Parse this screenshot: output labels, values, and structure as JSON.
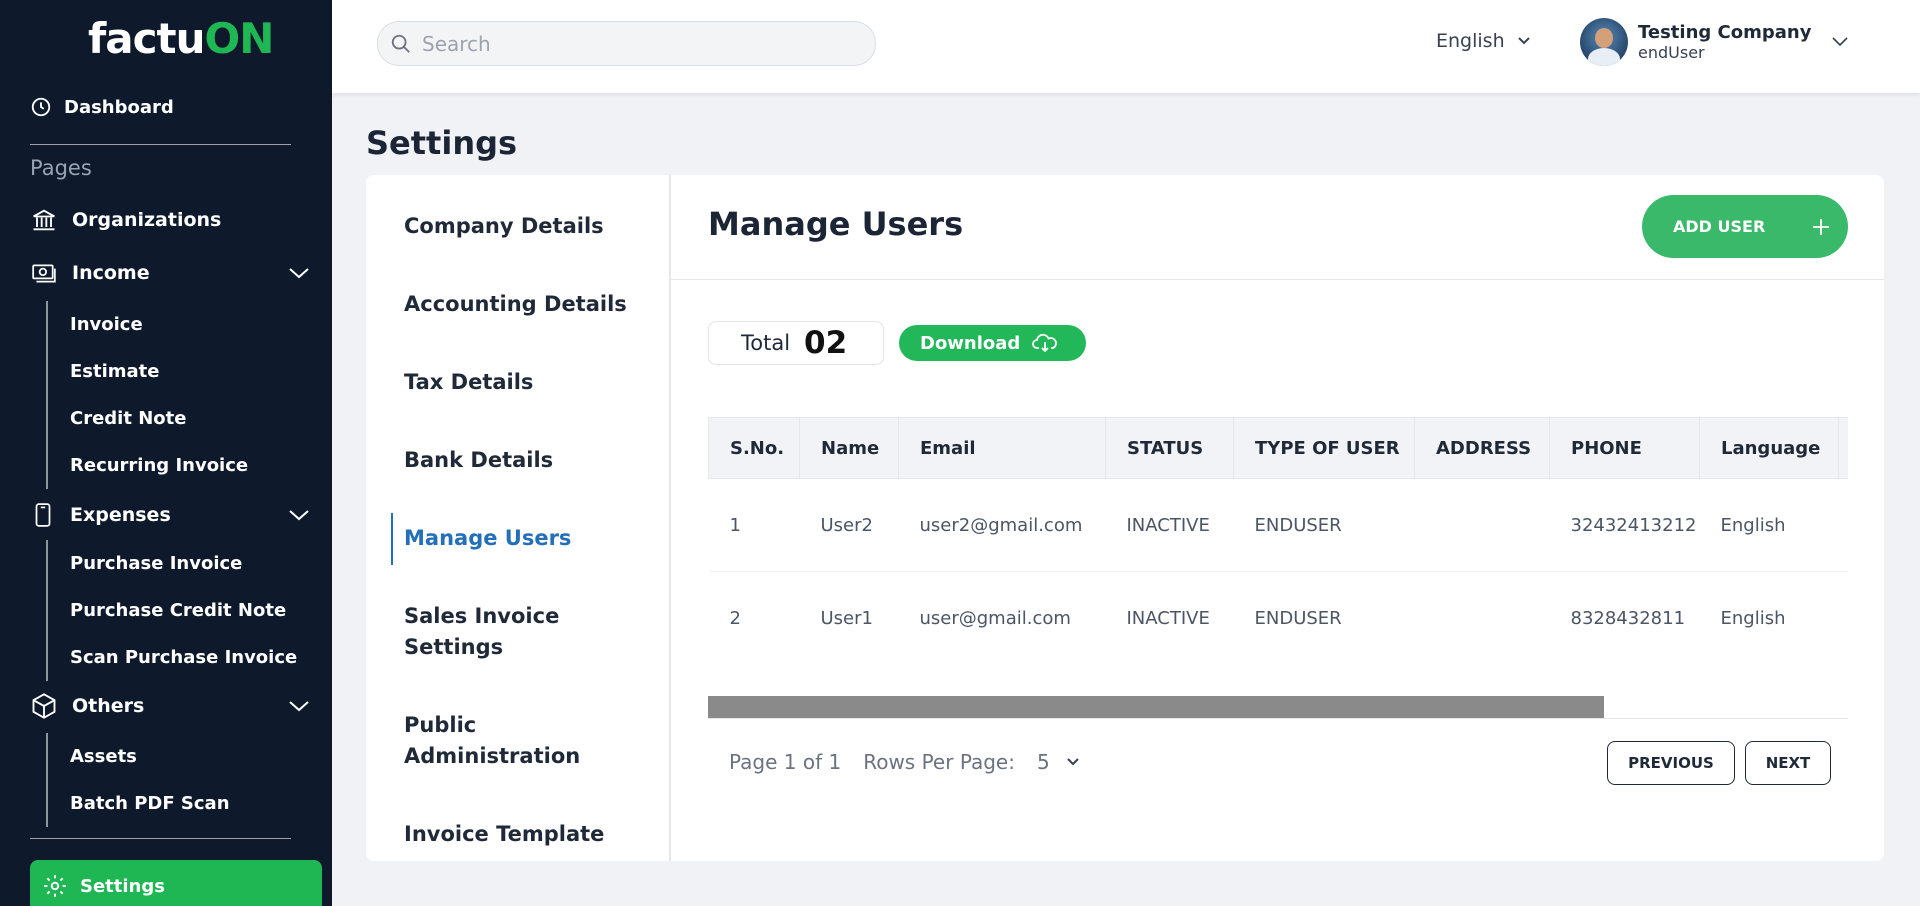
{
  "brand": {
    "logo_part1": "actu",
    "logo_part2": "ON",
    "logo_prefix": "f"
  },
  "sidebar": {
    "dashboard": "Dashboard",
    "pages_label": "Pages",
    "organizations": "Organizations",
    "income": {
      "label": "Income",
      "items": [
        "Invoice",
        "Estimate",
        "Credit Note",
        "Recurring Invoice"
      ]
    },
    "expenses": {
      "label": "Expenses",
      "items": [
        "Purchase Invoice",
        "Purchase Credit Note",
        "Scan Purchase Invoice"
      ]
    },
    "others": {
      "label": "Others",
      "items": [
        "Assets",
        "Batch PDF Scan"
      ]
    },
    "settings": "Settings"
  },
  "header": {
    "search_placeholder": "Search",
    "language": "English",
    "user_name": "Testing Company",
    "user_role": "endUser"
  },
  "page": {
    "title": "Settings"
  },
  "settings_nav": {
    "items": [
      "Company Details",
      "Accounting Details",
      "Tax Details",
      "Bank Details",
      "Manage Users",
      "Sales Invoice Settings",
      "Public Administration",
      "Invoice Template"
    ],
    "active": "Manage Users"
  },
  "manage_users": {
    "title": "Manage Users",
    "add_user_label": "ADD USER",
    "total_label": "Total",
    "total_count": "02",
    "download_label": "Download",
    "table": {
      "headers": [
        "S.No.",
        "Name",
        "Email",
        "STATUS",
        "TYPE OF USER",
        "ADDRESS",
        "PHONE",
        "Language",
        ""
      ],
      "rows": [
        [
          "1",
          "User2",
          "user2@gmail.com",
          "INACTIVE",
          "ENDUSER",
          "",
          "32432413212",
          "English",
          ""
        ],
        [
          "2",
          "User1",
          "user@gmail.com",
          "INACTIVE",
          "ENDUSER",
          "",
          "8328432811",
          "English",
          ""
        ]
      ]
    },
    "pagination": {
      "page_info": "Page 1 of 1",
      "rows_per_page_label": "Rows Per Page:",
      "rows_per_page_value": "5",
      "previous": "PREVIOUS",
      "next": "NEXT"
    }
  },
  "colors": {
    "sidebar_bg": "#0e1a2c",
    "brand_green": "#1fb754",
    "active_blue": "#2370b8"
  }
}
